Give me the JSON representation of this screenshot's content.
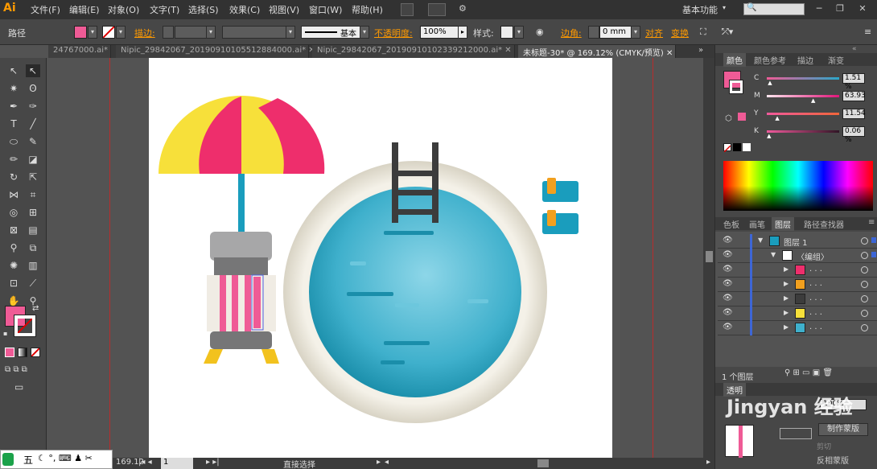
{
  "app": {
    "logo": "Ai"
  },
  "menu": [
    "文件(F)",
    "编辑(E)",
    "对象(O)",
    "文字(T)",
    "选择(S)",
    "效果(C)",
    "视图(V)",
    "窗口(W)",
    "帮助(H)"
  ],
  "workspace": {
    "label": "基本功能"
  },
  "control": {
    "path_label": "路径",
    "fill_color": "#ef5b96",
    "stroke_label": "描边:",
    "stroke_style": "基本",
    "opacity_label": "不透明度:",
    "opacity_value": "100%",
    "style_label": "样式:",
    "corner_label": "边角:",
    "corner_value": "0 mm",
    "align_label": "对齐",
    "transform_label": "变换"
  },
  "tabs": [
    {
      "label": "24767000.ai*"
    },
    {
      "label": "Nipic_29842067_20190910105512884000.ai*"
    },
    {
      "label": "Nipic_29842067_20190910102339212000.ai*"
    },
    {
      "label": "未标题-30* @ 169.12% (CMYK/预览)"
    }
  ],
  "colors": {
    "pink": "#ef5b96",
    "yellow": "#f7e03a",
    "hotpink": "#ee2e6c",
    "teal": "#1a9dbd",
    "pool_light": "#8dd6e8",
    "grey": "#a7a7a8",
    "orange": "#f2a01e",
    "ladder": "#3c3c3c"
  },
  "color_panel": {
    "tabs": [
      "颜色",
      "颜色参考",
      "描边",
      "渐变"
    ],
    "channels": [
      {
        "name": "C",
        "value": "1.51 %",
        "level": 0.015
      },
      {
        "name": "M",
        "value": "63.93",
        "level": 0.64
      },
      {
        "name": "Y",
        "value": "11.54",
        "level": 0.12
      },
      {
        "name": "K",
        "value": "0.06 %",
        "level": 0.001
      }
    ]
  },
  "layers_panel": {
    "tabs": [
      "色板",
      "画笔",
      "图层",
      "路径查找器"
    ],
    "rows": [
      {
        "name": "图层 1",
        "indent": 0,
        "open": true
      },
      {
        "name": "〈编组〉",
        "indent": 1,
        "open": true
      },
      {
        "name": ". . .",
        "indent": 2
      },
      {
        "name": ". . .",
        "indent": 2
      },
      {
        "name": ". . .",
        "indent": 2
      },
      {
        "name": ". . .",
        "indent": 2
      },
      {
        "name": ". . .",
        "indent": 2
      }
    ],
    "footer": "1 个图层"
  },
  "transparency": {
    "tab": "透明",
    "opacity": "100%",
    "mask_button": "制作蒙版",
    "clip_label": "剪切",
    "invert_label": "反相蒙版"
  },
  "watermark": "Jingyan 经验",
  "status": {
    "zoom": "169.12",
    "page": "1",
    "tool": "直接选择"
  },
  "taskbar": {
    "ime": "五"
  }
}
